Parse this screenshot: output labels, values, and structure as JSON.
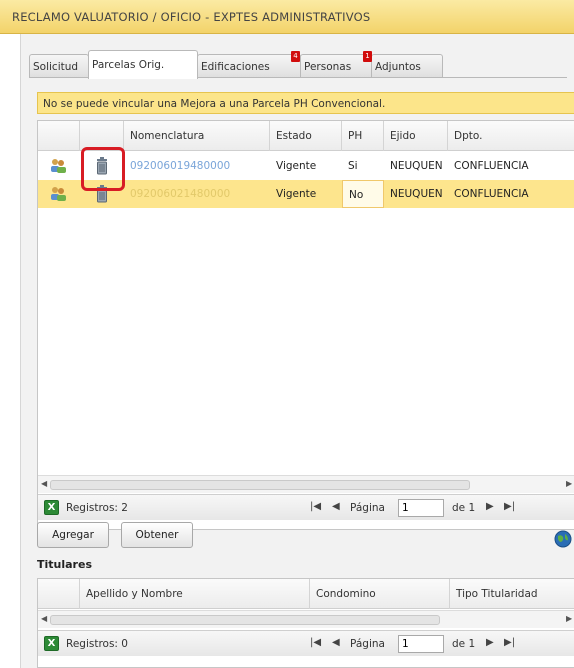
{
  "window": {
    "title": "RECLAMO VALUATORIO / OFICIO  -  EXPTES ADMINISTRATIVOS"
  },
  "tabs": [
    {
      "label": "Solicitud",
      "badge": ""
    },
    {
      "label": "Parcelas Orig.",
      "badge": "",
      "active": true
    },
    {
      "label": "Edificaciones",
      "badge": "4"
    },
    {
      "label": "Personas",
      "badge": "1"
    },
    {
      "label": "Adjuntos",
      "badge": ""
    }
  ],
  "warning": "No se puede vincular una Mejora a una Parcela PH Convencional.",
  "parcelas": {
    "columns": [
      "Nomenclatura",
      "Estado",
      "PH",
      "Ejido",
      "Dpto."
    ],
    "rows": [
      {
        "nomenclatura": "092006019480000",
        "estado": "Vigente",
        "ph": "Si",
        "ejido": "NEUQUEN",
        "dpto": "CONFLUENCIA"
      },
      {
        "nomenclatura": "092006021480000",
        "estado": "Vigente",
        "ph": "No",
        "ejido": "NEUQUEN",
        "dpto": "CONFLUENCIA"
      }
    ],
    "pager": {
      "registros": "Registros: 2",
      "pagina_label": "Página",
      "pagina_value": "1",
      "de_label": "de 1"
    }
  },
  "buttons": {
    "agregar": "Agregar",
    "obtener": "Obtener"
  },
  "titulares": {
    "title": "Titulares",
    "columns": [
      "Apellido y Nombre",
      "Condomino",
      "Tipo Titularidad"
    ],
    "pager": {
      "registros": "Registros: 0",
      "pagina_label": "Página",
      "pagina_value": "1",
      "de_label": "de 1"
    }
  },
  "colors": {
    "accent": "#fde58d",
    "link": "#7aa5d9",
    "highlight": "#d81c24",
    "badge": "#d10d0d"
  },
  "icons": [
    "users-icon",
    "trash-icon",
    "excel-icon",
    "globe-icon"
  ]
}
